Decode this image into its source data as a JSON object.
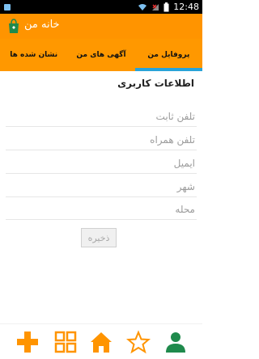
{
  "status_bar": {
    "time": "12:48"
  },
  "app": {
    "title": "خانه من",
    "logo_icon": "shopping-bag-icon",
    "accent": "#ff9400"
  },
  "tabs": [
    {
      "label": "پروفایل من",
      "active": true
    },
    {
      "label": "آگهی های من",
      "active": false
    },
    {
      "label": "نشان شده ها",
      "active": false
    }
  ],
  "form": {
    "section_title": "اطلاعات کاربری",
    "fields": [
      {
        "placeholder": "تلفن ثابت",
        "value": ""
      },
      {
        "placeholder": "تلفن همراه",
        "value": ""
      },
      {
        "placeholder": "ایمیل",
        "value": ""
      },
      {
        "placeholder": "شهر",
        "value": ""
      },
      {
        "placeholder": "محله",
        "value": ""
      }
    ],
    "save_label": "ذخیره"
  },
  "bottom_nav": {
    "items": [
      {
        "icon": "plus-icon",
        "color": "#ff9400"
      },
      {
        "icon": "grid-icon",
        "color": "#ff9400"
      },
      {
        "icon": "home-icon",
        "color": "#ff9400"
      },
      {
        "icon": "star-icon",
        "color": "#ff9400"
      },
      {
        "icon": "user-icon",
        "color": "#1f8a4c"
      }
    ]
  }
}
